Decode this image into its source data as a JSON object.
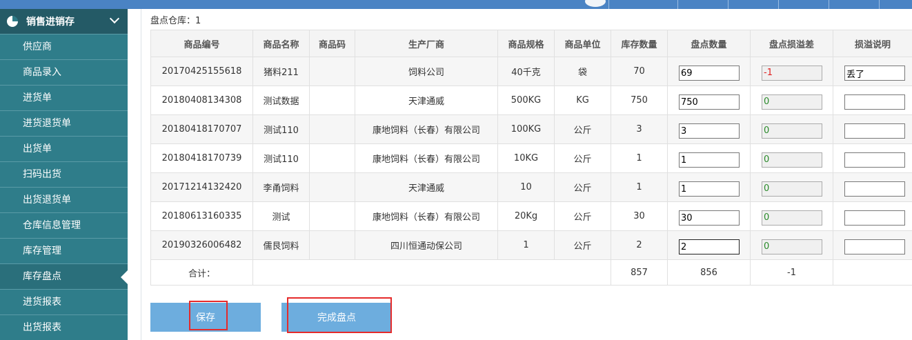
{
  "sidebar": {
    "title": "销售进销存",
    "items": [
      {
        "label": "供应商"
      },
      {
        "label": "商品录入"
      },
      {
        "label": "进货单"
      },
      {
        "label": "进货退货单"
      },
      {
        "label": "出货单"
      },
      {
        "label": "扫码出货"
      },
      {
        "label": "出货退货单"
      },
      {
        "label": "仓库信息管理"
      },
      {
        "label": "库存管理"
      },
      {
        "label": "库存盘点"
      },
      {
        "label": "进货报表"
      },
      {
        "label": "出货报表"
      }
    ],
    "active_index": 9
  },
  "main": {
    "warehouse_label": "盘点仓库：1",
    "columns": [
      "商品编号",
      "商品名称",
      "商品码",
      "生产厂商",
      "商品规格",
      "商品单位",
      "库存数量",
      "盘点数量",
      "盘点损溢差",
      "损溢说明"
    ],
    "rows": [
      {
        "code": "20170425155618",
        "name": "猪料211",
        "barcode": "",
        "maker": "饲料公司",
        "spec": "40千克",
        "unit": "袋",
        "stock": "70",
        "count": "69",
        "diff": "-1",
        "note": "丢了"
      },
      {
        "code": "20180408134308",
        "name": "测试数据",
        "barcode": "",
        "maker": "天津通威",
        "spec": "500KG",
        "unit": "KG",
        "stock": "750",
        "count": "750",
        "diff": "0",
        "note": ""
      },
      {
        "code": "20180418170707",
        "name": "测试110",
        "barcode": "",
        "maker": "康地饲料（长春）有限公司",
        "spec": "100KG",
        "unit": "公斤",
        "stock": "3",
        "count": "3",
        "diff": "0",
        "note": ""
      },
      {
        "code": "20180418170739",
        "name": "测试110",
        "barcode": "",
        "maker": "康地饲料（长春）有限公司",
        "spec": "10KG",
        "unit": "公斤",
        "stock": "1",
        "count": "1",
        "diff": "0",
        "note": ""
      },
      {
        "code": "20171214132420",
        "name": "李甬饲料",
        "barcode": "",
        "maker": "天津通威",
        "spec": "10",
        "unit": "公斤",
        "stock": "1",
        "count": "1",
        "diff": "0",
        "note": ""
      },
      {
        "code": "20180613160335",
        "name": "测试",
        "barcode": "",
        "maker": "康地饲料（长春）有限公司",
        "spec": "20Kg",
        "unit": "公斤",
        "stock": "30",
        "count": "30",
        "diff": "0",
        "note": ""
      },
      {
        "code": "20190326006482",
        "name": "儒艮饲料",
        "barcode": "",
        "maker": "四川恒通动保公司",
        "spec": "1",
        "unit": "公斤",
        "stock": "2",
        "count": "2",
        "diff": "0",
        "note": ""
      }
    ],
    "totals": {
      "label": "合计：",
      "stock": "857",
      "count": "856",
      "diff": "-1"
    },
    "buttons": {
      "save": "保存",
      "finish": "完成盘点"
    }
  },
  "colors": {
    "sidebar_bg": "#2d7a87",
    "button_bg": "#6dadde",
    "highlight_border": "#e52a2a",
    "negative": "#e02020",
    "positive": "#2a8a2a"
  }
}
